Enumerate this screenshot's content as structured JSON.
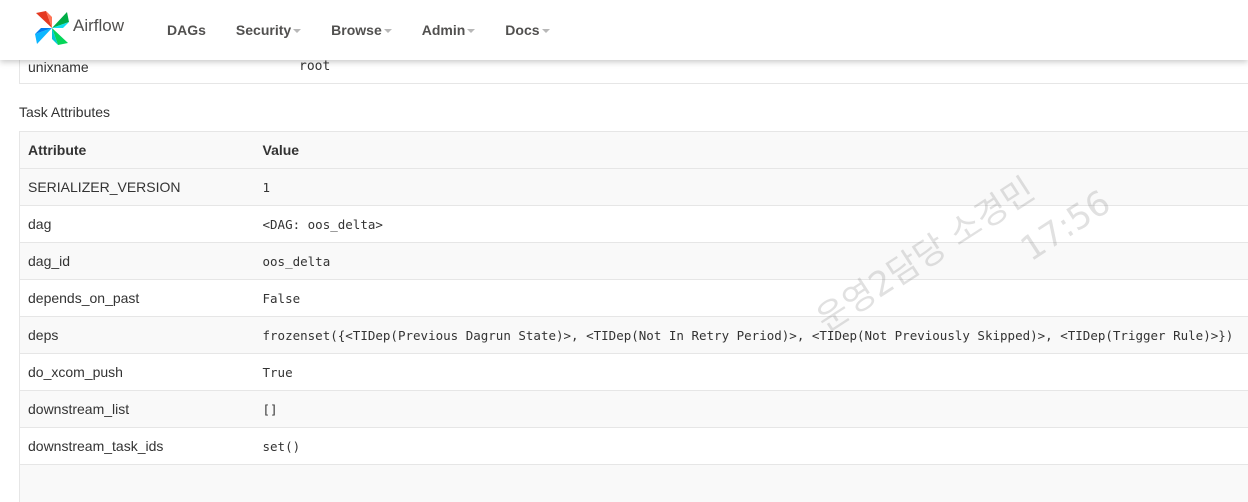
{
  "navbar": {
    "brand": "Airflow",
    "logo_icon": "airflow-pinwheel-icon",
    "items": [
      {
        "label": "DAGs",
        "has_dropdown": false
      },
      {
        "label": "Security",
        "has_dropdown": true
      },
      {
        "label": "Browse",
        "has_dropdown": true
      },
      {
        "label": "Admin",
        "has_dropdown": true
      },
      {
        "label": "Docs",
        "has_dropdown": true
      }
    ]
  },
  "top_row": {
    "attribute": "unixname",
    "value": "root"
  },
  "task_attributes": {
    "title": "Task Attributes",
    "headers": [
      "Attribute",
      "Value"
    ],
    "rows": [
      {
        "attribute": "SERIALIZER_VERSION",
        "value": "1"
      },
      {
        "attribute": "dag",
        "value": "<DAG: oos_delta>"
      },
      {
        "attribute": "dag_id",
        "value": "oos_delta"
      },
      {
        "attribute": "depends_on_past",
        "value": "False"
      },
      {
        "attribute": "deps",
        "value": "frozenset({<TIDep(Previous Dagrun State)>, <TIDep(Not In Retry Period)>, <TIDep(Not Previously Skipped)>, <TIDep(Trigger Rule)>})"
      },
      {
        "attribute": "do_xcom_push",
        "value": "True"
      },
      {
        "attribute": "downstream_list",
        "value": "[]"
      },
      {
        "attribute": "downstream_task_ids",
        "value": "set()"
      },
      {
        "attribute": "",
        "value": ""
      }
    ]
  },
  "watermark": {
    "line1": "운영2담당 소경민",
    "line2": "17:56"
  }
}
